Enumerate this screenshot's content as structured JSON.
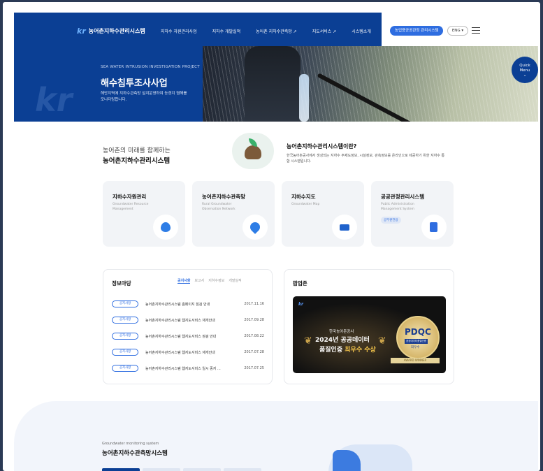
{
  "header": {
    "logo_mark": "kr",
    "logo_text": "농어촌지하수관리시스템",
    "nav": [
      {
        "label": "지하수 자원관리사업"
      },
      {
        "label": "지하수 개발실적"
      },
      {
        "label": "농어촌 지하수관측망 ↗"
      },
      {
        "label": "지도서비스 ↗"
      },
      {
        "label": "시스템소개"
      }
    ],
    "admin_button": "농업용공공관정 관리시스템",
    "lang": "ENG ▾"
  },
  "hero": {
    "en": "SEA WATER INTRUSION INVESTIGATION PROJECT",
    "title": "해수침투조사사업",
    "desc": "해안지역에 지하수관측망 설치운영하여 농경지 염해를 모니터링합니다.",
    "deco": "kr"
  },
  "quick_menu": {
    "line1": "Quick",
    "line2": "Menu",
    "arrow": "⌄"
  },
  "intro": {
    "sub": "농어촌의 미래를 함께하는",
    "title": "농어촌지하수관리시스템",
    "question": "농어촌지하수관리시스템이란?",
    "desc": "한국농어촌공사에서 생성되는 지하수 주제도정보, 시설정보, 관측정보를 온라인으로 제공하기 위한 지하수 통합 시스템입니다."
  },
  "cards": [
    {
      "title": "지하수자원관리",
      "en": "Groundwater Resource Management",
      "icon": "water-drop-icon"
    },
    {
      "title": "농어촌지하수관측망",
      "en": "Rural Groundwater Observation Network",
      "icon": "map-pin-icon"
    },
    {
      "title": "지하수지도",
      "en": "Groundwater Map",
      "icon": "map-icon"
    },
    {
      "title": "공공관정관리시스템",
      "en": "Public Administration Management System",
      "badge": "공무원전용",
      "icon": "document-icon"
    }
  ],
  "info": {
    "title": "정보마당",
    "tabs": [
      "공지사항",
      "보고서",
      "지하수정보",
      "개발실적"
    ],
    "notices": [
      {
        "tag": "공지사항",
        "title": "농어촌지하수관리시스템 홈페이지 점검 안내",
        "date": "2017.11.16"
      },
      {
        "tag": "공지사항",
        "title": "농어촌지하수관리시스템 웹지도서비스 재개안내",
        "date": "2017.09.28"
      },
      {
        "tag": "공지사항",
        "title": "농어촌지하수관리시스템 웹지도서비스 점검 안내",
        "date": "2017.08.22"
      },
      {
        "tag": "공지사항",
        "title": "농어촌지하수관리시스템 웹지도서비스 재개안내",
        "date": "2017.07.28"
      },
      {
        "tag": "공지사항",
        "title": "농어촌지하수관리시스템 웹지도서비스 일시 중지 ...",
        "date": "2017.07.25"
      }
    ]
  },
  "popup_zone": {
    "title": "팝업존",
    "logo": "kr",
    "org": "한국농어촌공사",
    "line1": "2024년 공공데이터",
    "line2a": "품질인증 ",
    "line2b": "최우수 수상",
    "seal_text": "PDQC",
    "seal_sub": "공공데이터품질인증",
    "seal_grade": "최우수",
    "seal_ribbon": "AWARD WINNER"
  },
  "bottom": {
    "en": "Groundwater monitoring system",
    "title": "농어촌지하수관측망시스템"
  },
  "colors": {
    "brand": "#0b3f94",
    "accent": "#2e6de0"
  }
}
